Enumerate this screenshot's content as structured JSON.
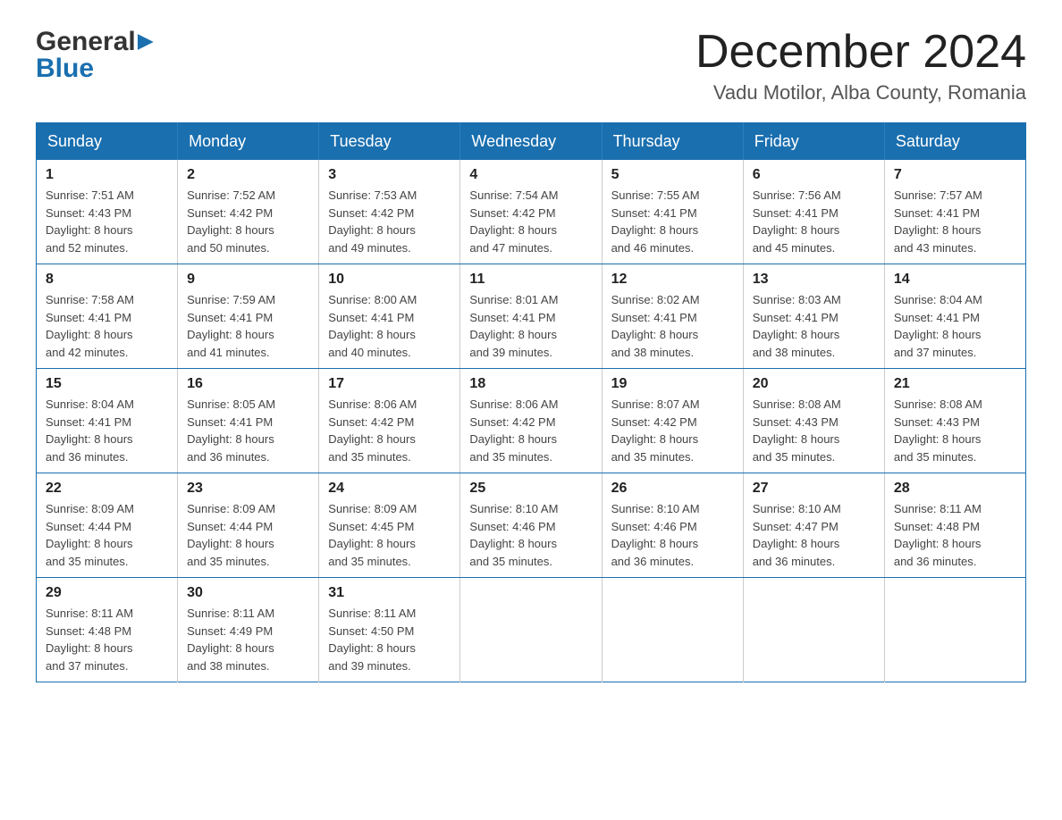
{
  "header": {
    "logo_general": "General",
    "logo_blue": "Blue",
    "month_title": "December 2024",
    "subtitle": "Vadu Motilor, Alba County, Romania"
  },
  "weekdays": [
    "Sunday",
    "Monday",
    "Tuesday",
    "Wednesday",
    "Thursday",
    "Friday",
    "Saturday"
  ],
  "weeks": [
    [
      {
        "day": "1",
        "sunrise": "7:51 AM",
        "sunset": "4:43 PM",
        "daylight": "8 hours and 52 minutes."
      },
      {
        "day": "2",
        "sunrise": "7:52 AM",
        "sunset": "4:42 PM",
        "daylight": "8 hours and 50 minutes."
      },
      {
        "day": "3",
        "sunrise": "7:53 AM",
        "sunset": "4:42 PM",
        "daylight": "8 hours and 49 minutes."
      },
      {
        "day": "4",
        "sunrise": "7:54 AM",
        "sunset": "4:42 PM",
        "daylight": "8 hours and 47 minutes."
      },
      {
        "day": "5",
        "sunrise": "7:55 AM",
        "sunset": "4:41 PM",
        "daylight": "8 hours and 46 minutes."
      },
      {
        "day": "6",
        "sunrise": "7:56 AM",
        "sunset": "4:41 PM",
        "daylight": "8 hours and 45 minutes."
      },
      {
        "day": "7",
        "sunrise": "7:57 AM",
        "sunset": "4:41 PM",
        "daylight": "8 hours and 43 minutes."
      }
    ],
    [
      {
        "day": "8",
        "sunrise": "7:58 AM",
        "sunset": "4:41 PM",
        "daylight": "8 hours and 42 minutes."
      },
      {
        "day": "9",
        "sunrise": "7:59 AM",
        "sunset": "4:41 PM",
        "daylight": "8 hours and 41 minutes."
      },
      {
        "day": "10",
        "sunrise": "8:00 AM",
        "sunset": "4:41 PM",
        "daylight": "8 hours and 40 minutes."
      },
      {
        "day": "11",
        "sunrise": "8:01 AM",
        "sunset": "4:41 PM",
        "daylight": "8 hours and 39 minutes."
      },
      {
        "day": "12",
        "sunrise": "8:02 AM",
        "sunset": "4:41 PM",
        "daylight": "8 hours and 38 minutes."
      },
      {
        "day": "13",
        "sunrise": "8:03 AM",
        "sunset": "4:41 PM",
        "daylight": "8 hours and 38 minutes."
      },
      {
        "day": "14",
        "sunrise": "8:04 AM",
        "sunset": "4:41 PM",
        "daylight": "8 hours and 37 minutes."
      }
    ],
    [
      {
        "day": "15",
        "sunrise": "8:04 AM",
        "sunset": "4:41 PM",
        "daylight": "8 hours and 36 minutes."
      },
      {
        "day": "16",
        "sunrise": "8:05 AM",
        "sunset": "4:41 PM",
        "daylight": "8 hours and 36 minutes."
      },
      {
        "day": "17",
        "sunrise": "8:06 AM",
        "sunset": "4:42 PM",
        "daylight": "8 hours and 35 minutes."
      },
      {
        "day": "18",
        "sunrise": "8:06 AM",
        "sunset": "4:42 PM",
        "daylight": "8 hours and 35 minutes."
      },
      {
        "day": "19",
        "sunrise": "8:07 AM",
        "sunset": "4:42 PM",
        "daylight": "8 hours and 35 minutes."
      },
      {
        "day": "20",
        "sunrise": "8:08 AM",
        "sunset": "4:43 PM",
        "daylight": "8 hours and 35 minutes."
      },
      {
        "day": "21",
        "sunrise": "8:08 AM",
        "sunset": "4:43 PM",
        "daylight": "8 hours and 35 minutes."
      }
    ],
    [
      {
        "day": "22",
        "sunrise": "8:09 AM",
        "sunset": "4:44 PM",
        "daylight": "8 hours and 35 minutes."
      },
      {
        "day": "23",
        "sunrise": "8:09 AM",
        "sunset": "4:44 PM",
        "daylight": "8 hours and 35 minutes."
      },
      {
        "day": "24",
        "sunrise": "8:09 AM",
        "sunset": "4:45 PM",
        "daylight": "8 hours and 35 minutes."
      },
      {
        "day": "25",
        "sunrise": "8:10 AM",
        "sunset": "4:46 PM",
        "daylight": "8 hours and 35 minutes."
      },
      {
        "day": "26",
        "sunrise": "8:10 AM",
        "sunset": "4:46 PM",
        "daylight": "8 hours and 36 minutes."
      },
      {
        "day": "27",
        "sunrise": "8:10 AM",
        "sunset": "4:47 PM",
        "daylight": "8 hours and 36 minutes."
      },
      {
        "day": "28",
        "sunrise": "8:11 AM",
        "sunset": "4:48 PM",
        "daylight": "8 hours and 36 minutes."
      }
    ],
    [
      {
        "day": "29",
        "sunrise": "8:11 AM",
        "sunset": "4:48 PM",
        "daylight": "8 hours and 37 minutes."
      },
      {
        "day": "30",
        "sunrise": "8:11 AM",
        "sunset": "4:49 PM",
        "daylight": "8 hours and 38 minutes."
      },
      {
        "day": "31",
        "sunrise": "8:11 AM",
        "sunset": "4:50 PM",
        "daylight": "8 hours and 39 minutes."
      },
      null,
      null,
      null,
      null
    ]
  ],
  "labels": {
    "sunrise": "Sunrise:",
    "sunset": "Sunset:",
    "daylight": "Daylight:"
  }
}
